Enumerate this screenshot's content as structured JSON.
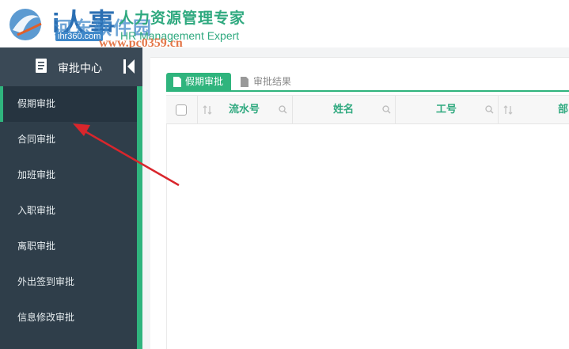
{
  "header": {
    "logo_text": "i人事",
    "watermark_site": "河东软件园",
    "watermark_url1": "ihr360.com",
    "brand_title": "人力资源管理专家",
    "brand_subtitle": "HR Management Expert",
    "watermark_url2": "www.pc0359.cn"
  },
  "sidebar": {
    "title": "审批中心",
    "header_icon": "document-icon",
    "collapse_icon": "collapse-left-icon",
    "items": [
      {
        "label": "假期审批",
        "active": true
      },
      {
        "label": "合同审批",
        "active": false
      },
      {
        "label": "加班审批",
        "active": false
      },
      {
        "label": "入职审批",
        "active": false
      },
      {
        "label": "离职审批",
        "active": false
      },
      {
        "label": "外出签到审批",
        "active": false
      },
      {
        "label": "信息修改审批",
        "active": false
      }
    ]
  },
  "tabs": [
    {
      "label": "假期审批",
      "active": true,
      "icon": "document-icon"
    },
    {
      "label": "审批结果",
      "active": false,
      "icon": "document-icon"
    }
  ],
  "table": {
    "columns": [
      "流水号",
      "姓名",
      "工号",
      "部"
    ]
  },
  "colors": {
    "accent": "#2fb47d",
    "sidebar_bg": "#2f3e4a",
    "arrow": "#d9262c"
  }
}
